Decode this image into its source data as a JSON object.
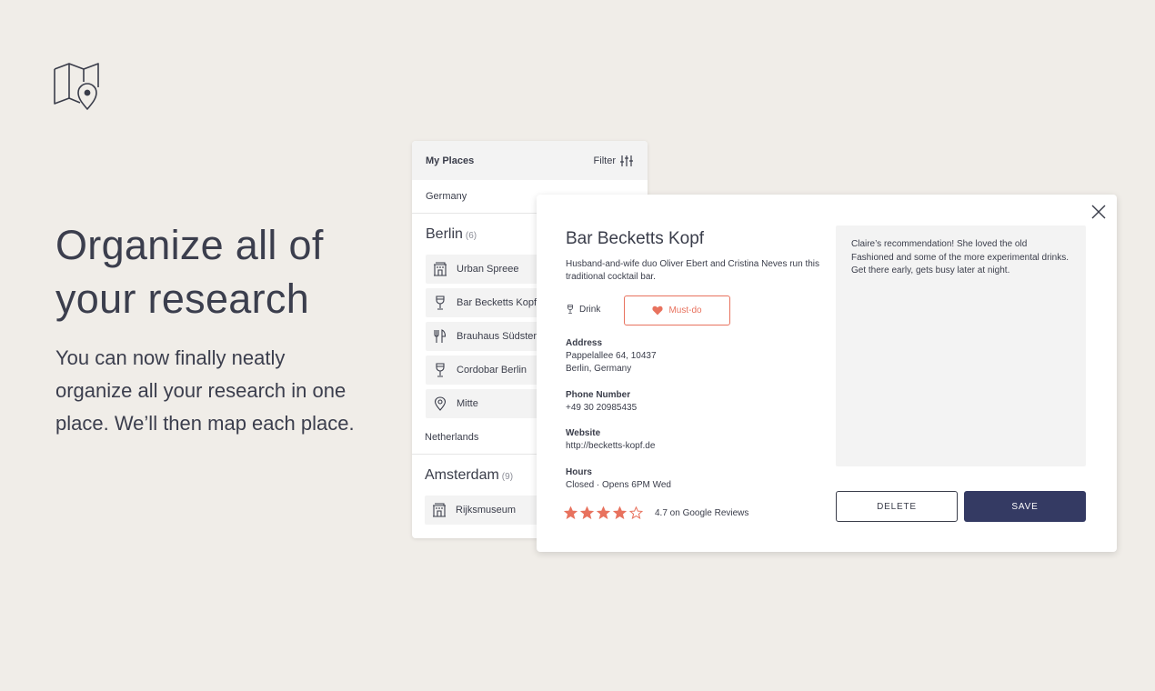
{
  "colors": {
    "background": "#f0ede8",
    "accent": "#e8725e",
    "primary": "#343a63",
    "text": "#3a3d4a"
  },
  "logo_icon": "map-pin-icon",
  "hero": {
    "title": "Organize all of your research",
    "body": "You can now finally neatly organize all your research in one place. We’ll then map each place."
  },
  "list": {
    "title": "My Places",
    "filter_label": "Filter",
    "groups": [
      {
        "country": "Germany",
        "city": "Berlin",
        "count": "(6)",
        "places": [
          {
            "name": "Urban Spreee",
            "icon": "building-icon"
          },
          {
            "name": "Bar Becketts Kopf",
            "icon": "drink-icon"
          },
          {
            "name": "Brauhaus Südstern",
            "icon": "restaurant-icon"
          },
          {
            "name": "Cordobar Berlin",
            "icon": "drink-icon"
          },
          {
            "name": "Mitte",
            "icon": "location-pin-icon"
          }
        ]
      },
      {
        "country": "Netherlands",
        "city": "Amsterdam",
        "count": "(9)",
        "places": [
          {
            "name": "Rijksmuseum",
            "icon": "building-icon"
          }
        ]
      }
    ]
  },
  "detail": {
    "name": "Bar Becketts Kopf",
    "description": "Husband-and-wife duo Oliver Ebert and Cristina Neves run this traditional cocktail bar.",
    "category": "Drink",
    "must_do_label": "Must-do",
    "address_label": "Address",
    "address_line1": "Pappelallee 64, 10437",
    "address_line2": "Berlin, Germany",
    "phone_label": "Phone Number",
    "phone": "+49 30 20985435",
    "website_label": "Website",
    "website": "http://becketts-kopf.de",
    "hours_label": "Hours",
    "hours": "Closed · Opens 6PM Wed",
    "rating": 4,
    "rating_max": 5,
    "rating_text": "4.7 on Google Reviews",
    "notes": "Claire’s recommendation! She loved the old Fashioned and some of the more experimental drinks. Get there early, gets busy later at night.",
    "delete_label": "DELETE",
    "save_label": "SAVE"
  }
}
